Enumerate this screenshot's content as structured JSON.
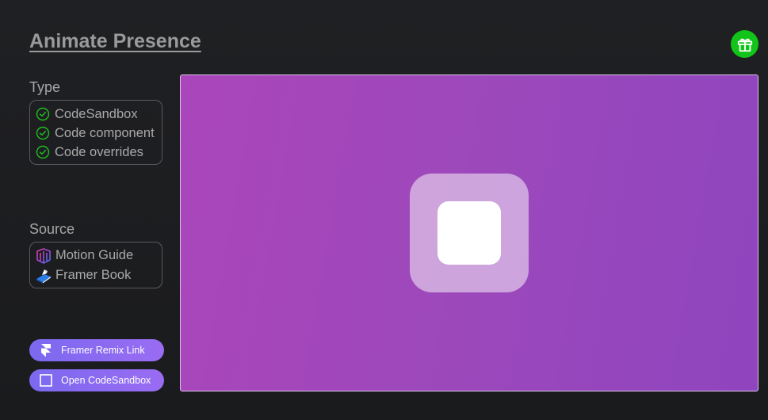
{
  "header": {
    "title": "Animate Presence",
    "gift_icon": "gift-icon"
  },
  "type_section": {
    "label": "Type",
    "items": [
      {
        "label": "CodeSandbox",
        "icon": "check-circle-icon"
      },
      {
        "label": "Code component",
        "icon": "check-circle-icon"
      },
      {
        "label": "Code overrides",
        "icon": "check-circle-icon"
      }
    ]
  },
  "source_section": {
    "label": "Source",
    "items": [
      {
        "label": "Motion Guide",
        "icon": "motion-guide-icon"
      },
      {
        "label": "Framer Book",
        "icon": "framer-book-icon"
      }
    ]
  },
  "buttons": {
    "remix": {
      "label": "Framer Remix Link",
      "icon": "framer-logo-icon"
    },
    "codesandbox": {
      "label": "Open CodeSandbox",
      "icon": "codesandbox-icon"
    }
  },
  "colors": {
    "accent_green": "#12c41a",
    "pill_gradient_start": "#7b69f0",
    "pill_gradient_end": "#9a6cf2",
    "preview_purple": "#a247bb"
  }
}
